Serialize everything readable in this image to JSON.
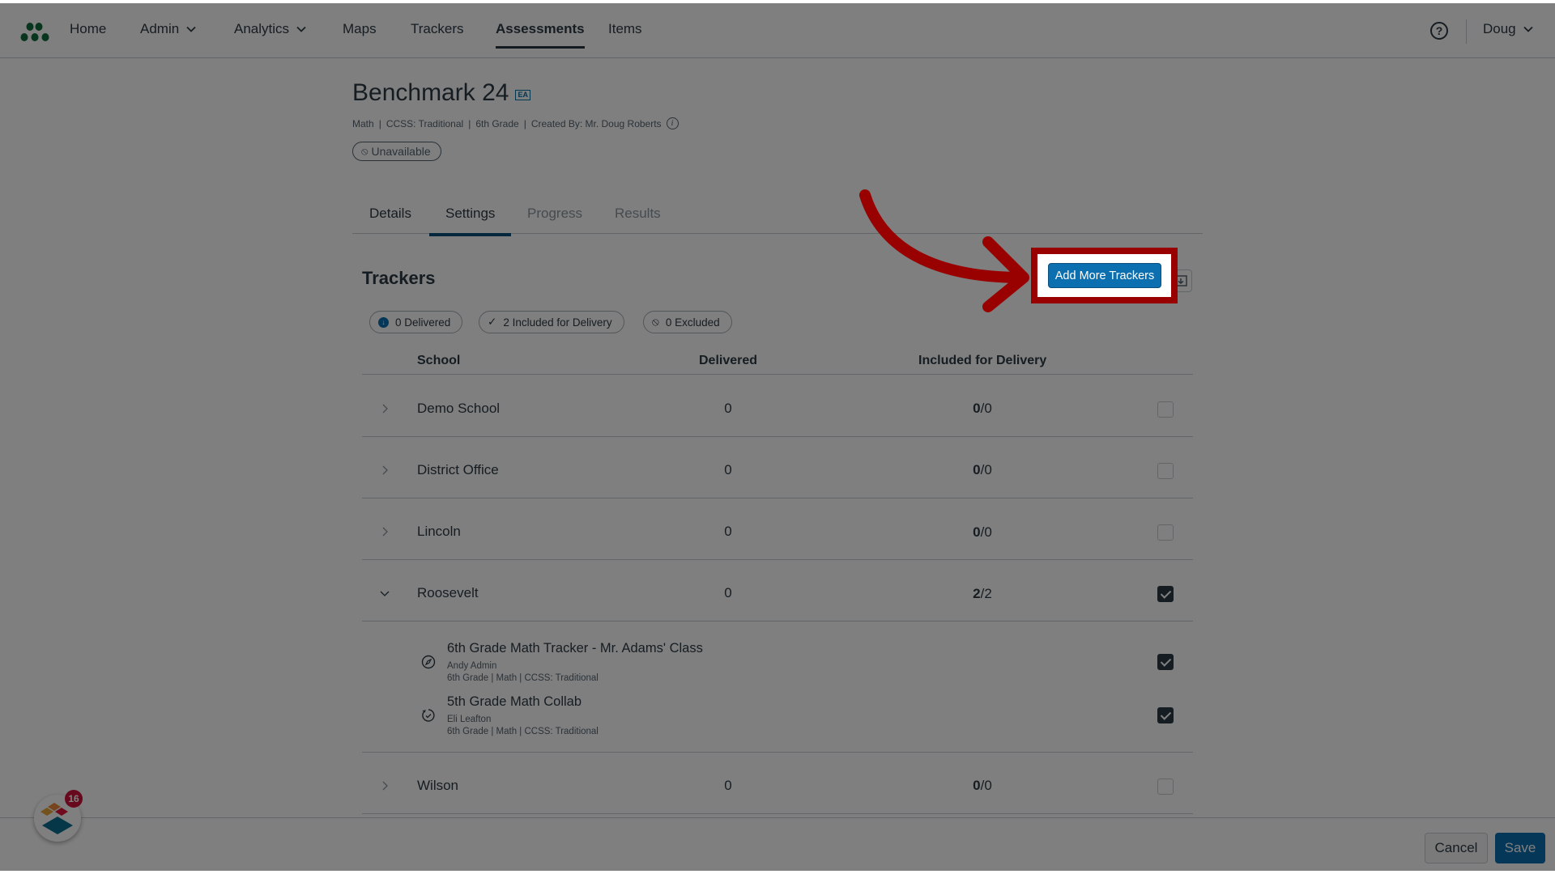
{
  "nav": {
    "items": [
      {
        "label": "Home",
        "dropdown": false
      },
      {
        "label": "Admin",
        "dropdown": true
      },
      {
        "label": "Analytics",
        "dropdown": true
      },
      {
        "label": "Maps",
        "dropdown": false
      },
      {
        "label": "Trackers",
        "dropdown": false
      },
      {
        "label": "Assessments",
        "dropdown": false,
        "active": true
      },
      {
        "label": "Items",
        "dropdown": false
      }
    ],
    "help_icon": "question-circle-icon",
    "help_glyph": "?",
    "user_name": "Doug"
  },
  "assessment": {
    "title": "Benchmark 24",
    "badge": "EA",
    "subject": "Math",
    "standard": "CCSS: Traditional",
    "grade": "6th Grade",
    "created_by": "Created By: Mr. Doug Roberts",
    "separator": "|",
    "info_glyph": "i",
    "status": "Unavailable",
    "status_glyph": "⦸"
  },
  "tabs": [
    {
      "label": "Details",
      "state": "normal"
    },
    {
      "label": "Settings",
      "state": "active"
    },
    {
      "label": "Progress",
      "state": "disabled"
    },
    {
      "label": "Results",
      "state": "disabled"
    }
  ],
  "trackers": {
    "section_title": "Trackers",
    "add_button_label": "Add More Trackers",
    "filters": [
      {
        "label": "0 Delivered",
        "icon": "download-circle-icon",
        "glyph": "↓"
      },
      {
        "label": "2 Included for Delivery",
        "icon": "check-icon",
        "glyph": "✓"
      },
      {
        "label": "0 Excluded",
        "icon": "ban-icon",
        "glyph": "⦸"
      }
    ],
    "columns": [
      "School",
      "Delivered",
      "Included for Delivery"
    ],
    "rows": [
      {
        "school": "Demo School",
        "delivered": "0",
        "included": "0",
        "total": "0",
        "expanded": false,
        "checked": false
      },
      {
        "school": "District Office",
        "delivered": "0",
        "included": "0",
        "total": "0",
        "expanded": false,
        "checked": false
      },
      {
        "school": "Lincoln",
        "delivered": "0",
        "included": "0",
        "total": "0",
        "expanded": false,
        "checked": false
      },
      {
        "school": "Roosevelt",
        "delivered": "0",
        "included": "2",
        "total": "2",
        "expanded": true,
        "checked": true,
        "trackers": [
          {
            "name": "6th Grade Math Tracker - Mr. Adams' Class",
            "owner": "Andy Admin",
            "meta": "6th Grade  |  Math  |  CCSS: Traditional",
            "icon": "compass-icon",
            "checked": true
          },
          {
            "name": "5th Grade Math Collab",
            "owner": "Eli Leafton",
            "meta": "6th Grade  |  Math  |  CCSS: Traditional",
            "icon": "refresh-check-icon",
            "checked": true
          }
        ]
      },
      {
        "school": "Wilson",
        "delivered": "0",
        "included": "0",
        "total": "0",
        "expanded": false,
        "checked": false
      }
    ]
  },
  "footer": {
    "cancel_label": "Cancel",
    "save_label": "Save"
  },
  "widget": {
    "badge_count": "16"
  },
  "overlay": {
    "highlight_color": "#990000",
    "dim_opacity": 0.5
  },
  "colors": {
    "brand_green": "#0f6b3a",
    "primary_blue": "#0b6fb0",
    "text": "#2d3b45"
  }
}
